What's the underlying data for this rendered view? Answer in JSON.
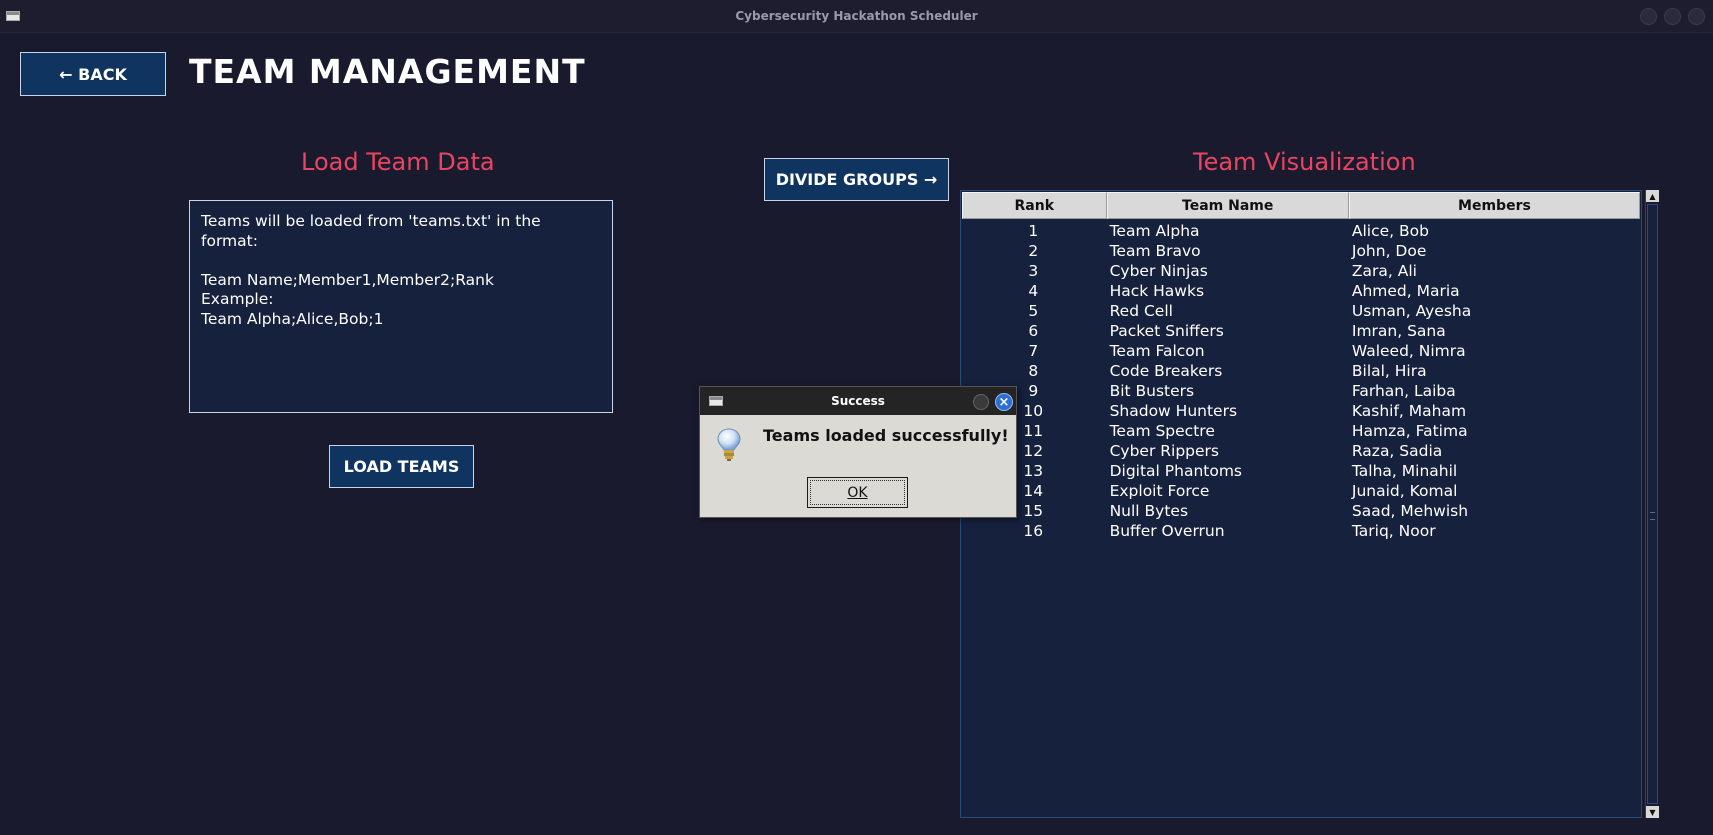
{
  "window": {
    "title": "Cybersecurity Hackathon Scheduler"
  },
  "header": {
    "back_label": "← BACK",
    "page_title": "TEAM MANAGEMENT"
  },
  "load_section": {
    "title": "Load Team Data",
    "info_text": "Teams will be loaded from 'teams.txt' in the\nformat:\n\nTeam Name;Member1,Member2;Rank\nExample:\nTeam Alpha;Alice,Bob;1",
    "load_button": "LOAD TEAMS"
  },
  "divide_button": "DIVIDE GROUPS →",
  "visualization": {
    "title": "Team Visualization",
    "columns": [
      "Rank",
      "Team Name",
      "Members"
    ],
    "rows": [
      {
        "rank": "1",
        "team": "Team Alpha",
        "members": "Alice, Bob"
      },
      {
        "rank": "2",
        "team": "Team Bravo",
        "members": "John, Doe"
      },
      {
        "rank": "3",
        "team": "Cyber Ninjas",
        "members": "Zara, Ali"
      },
      {
        "rank": "4",
        "team": "Hack Hawks",
        "members": "Ahmed, Maria"
      },
      {
        "rank": "5",
        "team": "Red Cell",
        "members": "Usman, Ayesha"
      },
      {
        "rank": "6",
        "team": "Packet Sniffers",
        "members": "Imran, Sana"
      },
      {
        "rank": "7",
        "team": "Team Falcon",
        "members": "Waleed, Nimra"
      },
      {
        "rank": "8",
        "team": "Code Breakers",
        "members": "Bilal, Hira"
      },
      {
        "rank": "9",
        "team": "Bit Busters",
        "members": "Farhan, Laiba"
      },
      {
        "rank": "10",
        "team": "Shadow Hunters",
        "members": "Kashif, Maham"
      },
      {
        "rank": "11",
        "team": "Team Spectre",
        "members": "Hamza, Fatima"
      },
      {
        "rank": "12",
        "team": "Cyber Rippers",
        "members": "Raza, Sadia"
      },
      {
        "rank": "13",
        "team": "Digital Phantoms",
        "members": "Talha, Minahil"
      },
      {
        "rank": "14",
        "team": "Exploit Force",
        "members": "Junaid, Komal"
      },
      {
        "rank": "15",
        "team": "Null Bytes",
        "members": "Saad, Mehwish"
      },
      {
        "rank": "16",
        "team": "Buffer Overrun",
        "members": "Tariq, Noor"
      }
    ]
  },
  "dialog": {
    "title": "Success",
    "message": "Teams loaded successfully!",
    "ok_label": "OK",
    "icon": "lightbulb-icon"
  },
  "colors": {
    "background": "#1a1a2e",
    "panel": "#16213e",
    "button": "#0f3460",
    "accent": "#e94560"
  }
}
